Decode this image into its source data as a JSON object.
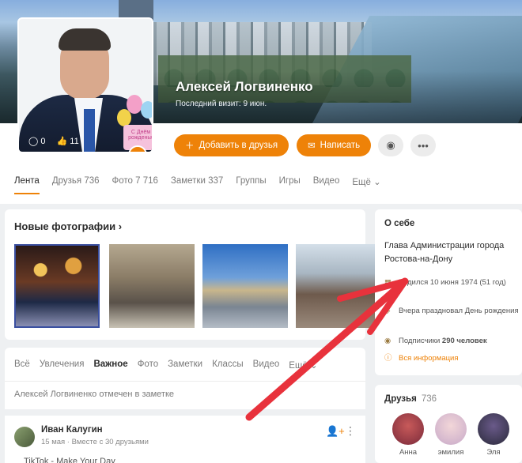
{
  "profile": {
    "name": "Алексей Логвиненко",
    "last_visit": "Последний визит: 9 июн.",
    "comments_count": "0",
    "likes_count": "11"
  },
  "actions": {
    "add_friend": "Добавить в друзья",
    "write": "Написать"
  },
  "tabs": [
    "Лента",
    "Друзья 736",
    "Фото 7 716",
    "Заметки 337",
    "Группы",
    "Игры",
    "Видео",
    "Ещё"
  ],
  "new_photos": {
    "title": "Новые фотографии"
  },
  "feed": {
    "tabs": [
      "Всё",
      "Увлечения",
      "Важное",
      "Фото",
      "Заметки",
      "Классы",
      "Видео",
      "Ещё"
    ],
    "mention": "Алексей Логвиненко отмечен в заметке",
    "post": {
      "author": "Иван Калугин",
      "meta": "15 мая · Вместе с 30 друзьями",
      "text": "TikTok - Make Your Day"
    }
  },
  "about": {
    "title": "О себе",
    "description": "Глава Администрации города Ростова-на-Дону",
    "birthday": "Родился 10 июня 1974 (51 год)",
    "celebrated": "Вчера праздновал День рождения",
    "subscribers_label": "Подписчики",
    "subscribers_count": "290 человек",
    "all_info": "Вся информация"
  },
  "friends": {
    "title": "Друзья",
    "count": "736",
    "items": [
      {
        "name": "Анна"
      },
      {
        "name": "эмилия"
      },
      {
        "name": "Эля"
      }
    ]
  },
  "colors": {
    "accent": "#ee8208",
    "annotation_arrow": "#e8323c"
  }
}
